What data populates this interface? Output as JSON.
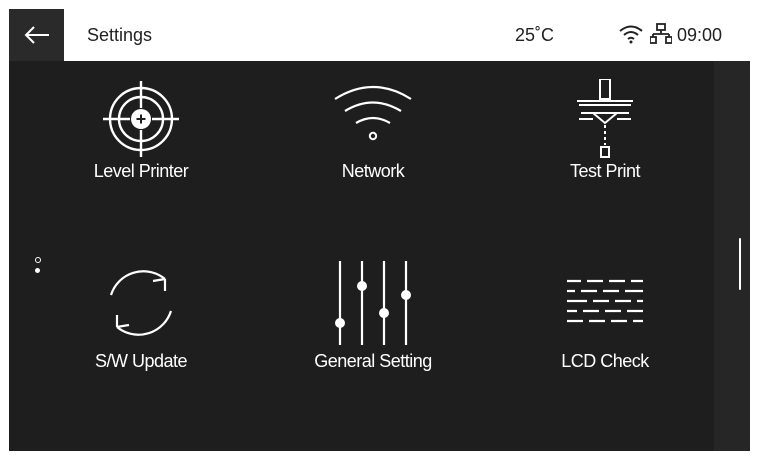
{
  "header": {
    "title": "Settings",
    "temperature": "25˚C",
    "time": "09:00",
    "icons": [
      "back-arrow-icon",
      "wifi-icon",
      "network-lan-icon"
    ]
  },
  "pager": {
    "pages": 2,
    "current": 2
  },
  "menu": [
    {
      "label": "Level Printer",
      "icon": "target-icon"
    },
    {
      "label": "Network",
      "icon": "wifi-icon"
    },
    {
      "label": "Test Print",
      "icon": "test-print-icon"
    },
    {
      "label": "S/W Update",
      "icon": "refresh-icon"
    },
    {
      "label": "General Setting",
      "icon": "sliders-icon"
    },
    {
      "label": "LCD Check",
      "icon": "lcd-check-icon"
    }
  ],
  "colors": {
    "background": "#1e1e1e",
    "topbar": "#ffffff",
    "text": "#ffffff"
  }
}
